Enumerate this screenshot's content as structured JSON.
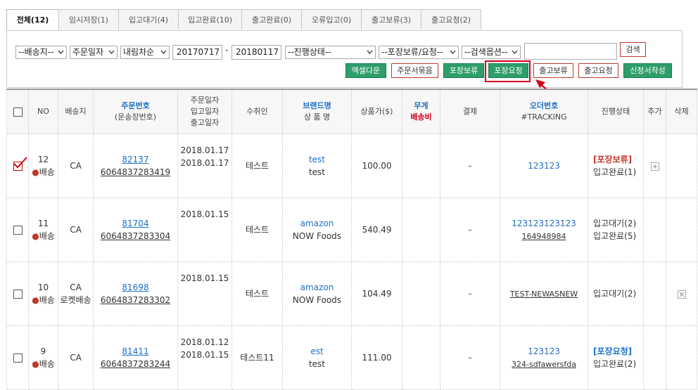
{
  "tabs": [
    {
      "label": "전체(12)",
      "active": true,
      "w": 75
    },
    {
      "label": "임시저장(1)",
      "active": false,
      "w": 86
    },
    {
      "label": "입고대기(4)",
      "active": false,
      "w": 86
    },
    {
      "label": "입고완료(10)",
      "active": false,
      "w": 91
    },
    {
      "label": "출고완료(0)",
      "active": false,
      "w": 86
    },
    {
      "label": "오류입고(0)",
      "active": false,
      "w": 86
    },
    {
      "label": "출고보류(3)",
      "active": false,
      "w": 86
    },
    {
      "label": "출고요청(2)",
      "active": false,
      "w": 86
    }
  ],
  "filters": {
    "ship_to": "--배송지--",
    "date_type": "주문일자",
    "sort": "내림차순",
    "date_from": "20170717",
    "range_sep": "-",
    "date_to": "20180117",
    "progress": "--진행상태--",
    "pack_status": "--포장보류/요청--",
    "search_option": "--검색옵션--",
    "search_value": "",
    "search_button": "검색"
  },
  "actions": {
    "excel": "엑셀다운",
    "order_bundle": "주문서묶음",
    "pack_hold": "포장보류",
    "pack_request": "포장요청",
    "ship_hold": "출고보류",
    "ship_request": "출고요청",
    "application": "신청서작성"
  },
  "columns": {
    "no": "NO",
    "ship_to": "배송지",
    "order_no": "주문번호",
    "order_no_sub": "(운송장번호)",
    "dates_1": "주문일자",
    "dates_2": "입고일자",
    "dates_3": "출고일자",
    "receiver": "수취인",
    "brand": "브랜드명",
    "product": "상 품 명",
    "price": "상품가($)",
    "weight": "무게",
    "shipping_fee": "배송비",
    "payment": "결제",
    "order_ref": "오더번호",
    "tracking": "#TRACKING",
    "progress": "진행상태",
    "add": "추가",
    "delete": "삭제"
  },
  "rows": [
    {
      "checked": true,
      "no": "12",
      "kind": "배송",
      "ship_to": "CA",
      "ship_to_2": "",
      "order_no": "82137",
      "waybill": "6064837283419",
      "date_1": "2018.01.17",
      "date_2": "2018.01.17",
      "receiver": "테스트",
      "brand": "test",
      "product": "test",
      "price": "100.00",
      "payment": "-",
      "order_ref": "123123",
      "tracking": "",
      "status_1": "[포장보류]",
      "status_1_color": "red",
      "status_2": "입고완료(1)",
      "action": "add"
    },
    {
      "checked": false,
      "no": "11",
      "kind": "배송",
      "ship_to": "CA",
      "ship_to_2": "",
      "order_no": "81704",
      "waybill": "6064837283304",
      "date_1": "2018.01.15",
      "date_2": "",
      "receiver": "테스트",
      "brand": "amazon",
      "product": "NOW Foods",
      "price": "540.49",
      "payment": "-",
      "order_ref": "123123123123",
      "tracking": "164948984",
      "status_1": "입고대기(2)",
      "status_1_color": "plain",
      "status_2": "입고완료(5)",
      "action": ""
    },
    {
      "checked": false,
      "no": "10",
      "kind": "배송",
      "ship_to": "CA",
      "ship_to_2": "로켓배송",
      "order_no": "81698",
      "waybill": "6064837283302",
      "date_1": "2018.01.15",
      "date_2": "",
      "receiver": "테스트",
      "brand": "amazon",
      "product": "NOW Foods",
      "price": "104.49",
      "payment": "-",
      "order_ref": "",
      "tracking": "TEST-NEWASNEW",
      "status_1": "입고대기(2)",
      "status_1_color": "plain",
      "status_2": "",
      "action": "delete"
    },
    {
      "checked": false,
      "no": "9",
      "kind": "배송",
      "ship_to": "CA",
      "ship_to_2": "",
      "order_no": "81411",
      "waybill": "6064837283244",
      "date_1": "2018.01.12",
      "date_2": "2018.01.15",
      "receiver": "테스트11",
      "brand": "est",
      "product": "test",
      "price": "111.00",
      "payment": "-",
      "order_ref": "123123",
      "tracking": "324-sdfawersfda",
      "status_1": "[포장요청]",
      "status_1_color": "blue",
      "status_2": "입고완료(2)",
      "action": ""
    }
  ]
}
